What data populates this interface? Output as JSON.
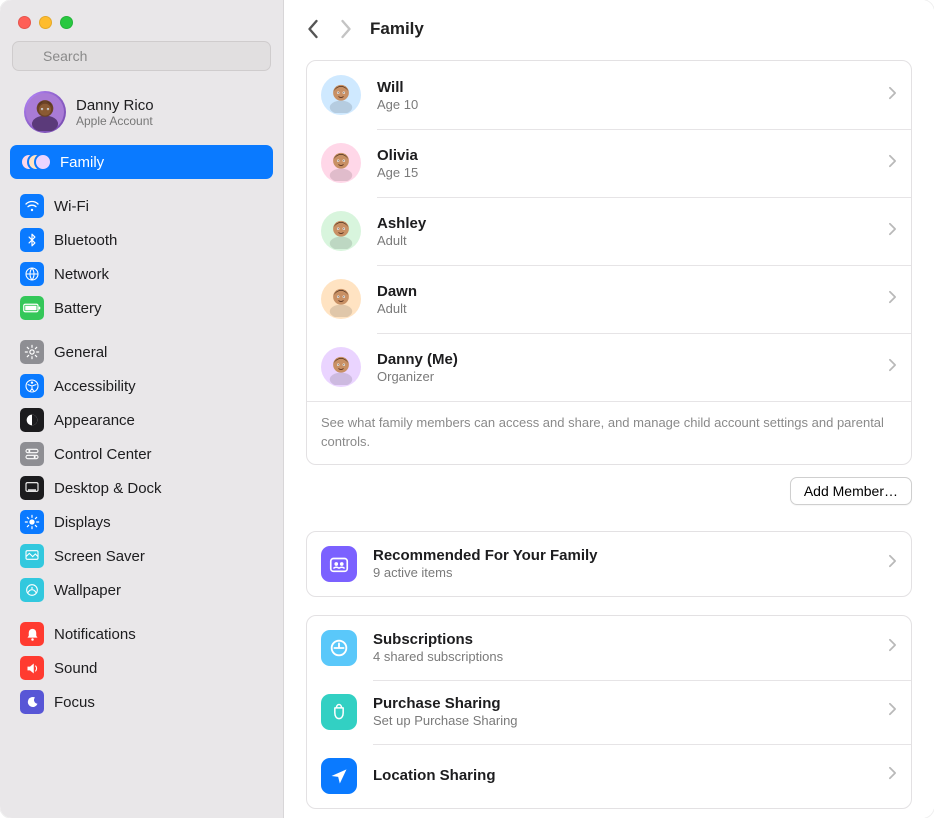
{
  "search": {
    "placeholder": "Search"
  },
  "account": {
    "name": "Danny Rico",
    "sub": "Apple Account"
  },
  "sidebar": {
    "family": "Family",
    "wifi": "Wi-Fi",
    "bluetooth": "Bluetooth",
    "network": "Network",
    "battery": "Battery",
    "general": "General",
    "accessibility": "Accessibility",
    "appearance": "Appearance",
    "controlcenter": "Control Center",
    "desktopdock": "Desktop & Dock",
    "displays": "Displays",
    "screensaver": "Screen Saver",
    "wallpaper": "Wallpaper",
    "notifications": "Notifications",
    "sound": "Sound",
    "focus": "Focus"
  },
  "header": {
    "title": "Family"
  },
  "members": [
    {
      "name": "Will",
      "sub": "Age 10",
      "bg": "#cfe9ff"
    },
    {
      "name": "Olivia",
      "sub": "Age 15",
      "bg": "#ffd7e8"
    },
    {
      "name": "Ashley",
      "sub": "Adult",
      "bg": "#d8f5dd"
    },
    {
      "name": "Dawn",
      "sub": "Adult",
      "bg": "#ffe3c2"
    },
    {
      "name": "Danny (Me)",
      "sub": "Organizer",
      "bg": "#ead4ff"
    }
  ],
  "members_footer": "See what family members can access and share, and manage child account settings and parental controls.",
  "add_button": "Add Member…",
  "recommended": {
    "title": "Recommended For Your Family",
    "sub": "9 active items"
  },
  "subscriptions": {
    "title": "Subscriptions",
    "sub": "4 shared subscriptions"
  },
  "purchase": {
    "title": "Purchase Sharing",
    "sub": "Set up Purchase Sharing"
  },
  "location": {
    "title": "Location Sharing"
  },
  "colors": {
    "accent": "#0a7aff",
    "blue": "#0a7aff",
    "green": "#34c759",
    "grey": "#8e8e93",
    "red": "#ff3b30",
    "teal": "#32d0c3",
    "purple": "#7b61ff",
    "skyblue": "#5ac8fa"
  }
}
